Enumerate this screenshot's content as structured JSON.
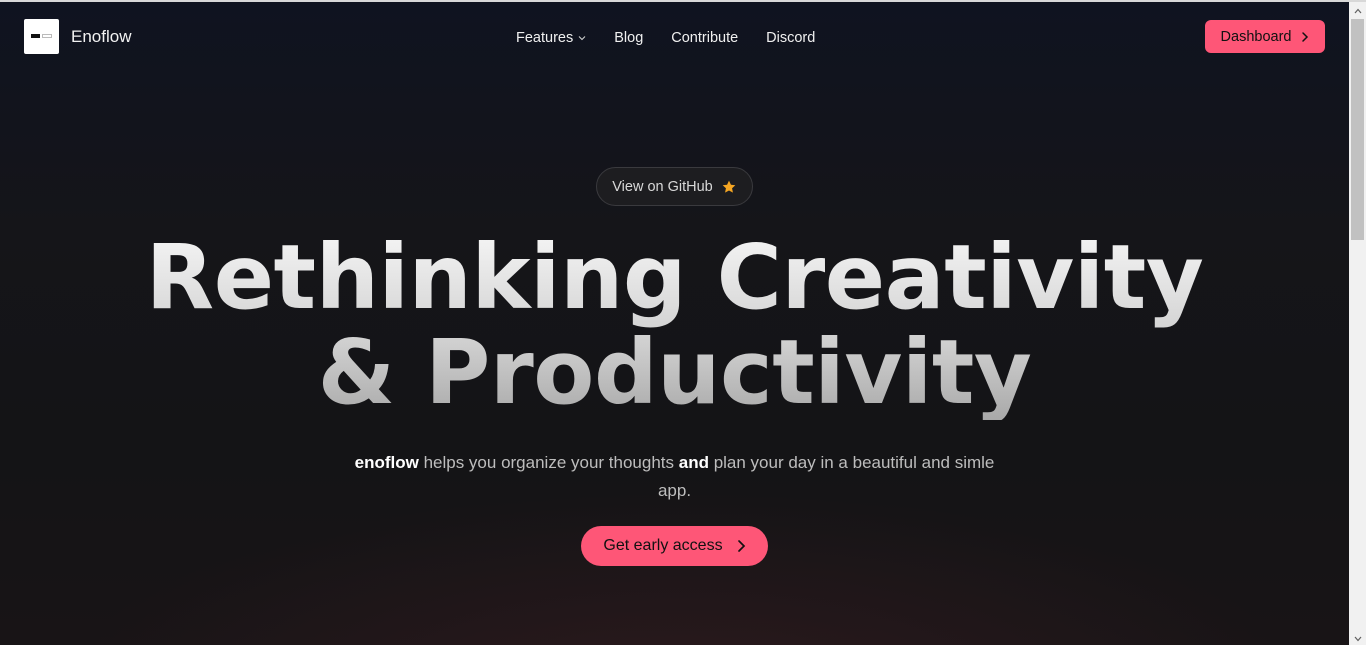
{
  "header": {
    "brand": "Enoflow",
    "nav": [
      {
        "label": "Features",
        "has_dropdown": true
      },
      {
        "label": "Blog"
      },
      {
        "label": "Contribute"
      },
      {
        "label": "Discord"
      }
    ],
    "dashboard_label": "Dashboard"
  },
  "hero": {
    "github_label": "View on GitHub",
    "headline_line1": "Rethinking Creativity",
    "headline_line2": "& Productivity",
    "sub_brand": "enoflow",
    "sub_part1": " helps you organize your thoughts ",
    "sub_and": "and",
    "sub_part2": " plan your day in a beautiful and simle app.",
    "cta_label": "Get early access"
  },
  "colors": {
    "accent": "#fe5677",
    "star": "#f5a623",
    "background": "#141416"
  },
  "icons": {
    "github_star": "star-icon",
    "dashboard_arrow": "chevron-right-icon",
    "cta_arrow": "chevron-right-icon",
    "features_dropdown": "chevron-down-icon"
  }
}
